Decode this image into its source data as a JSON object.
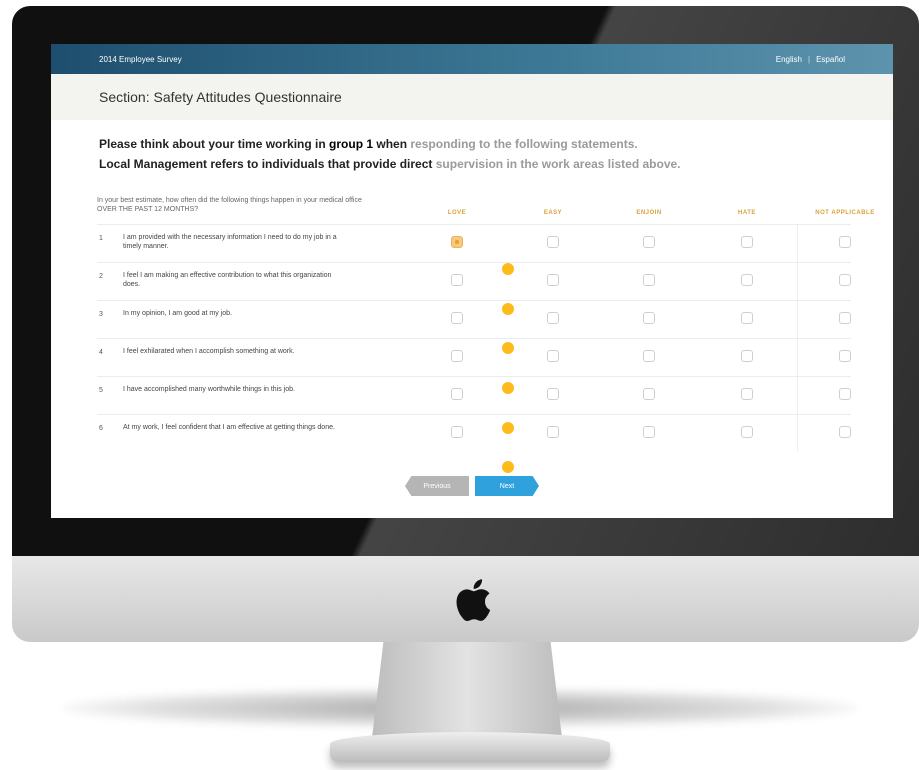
{
  "header": {
    "survey_title": "2014 Employee Survey",
    "lang_english": "English",
    "lang_sep": "|",
    "lang_espanol": "Español"
  },
  "section": {
    "title": "Section: Safety Attitudes Questionnaire"
  },
  "intro": {
    "line1_pre": "Please think about your time working in ",
    "line1_bold": "group 1",
    "line1_mid": " when ",
    "line1_fade": "responding to the following statements.",
    "line2_pre": "Local Management refers to individuals that provide direct ",
    "line2_fade": "supervision in the work areas listed above."
  },
  "question": {
    "prompt": "In your best estimate, how often did the following things happen in your medical office OVER THE PAST 12 MONTHS?",
    "columns": [
      "LOVE",
      "EASY",
      "ENJOIN",
      "HATE",
      "NOT APPLICABLE"
    ]
  },
  "rows": [
    {
      "num": "1",
      "text": "I am provided with the necessary information I need to do my job in a timely manner.",
      "selected": 0
    },
    {
      "num": "2",
      "text": "I feel I am making an effective contribution to what this organization does.",
      "selected": -1
    },
    {
      "num": "3",
      "text": "In my opinion, I am good at my job.",
      "selected": -1
    },
    {
      "num": "4",
      "text": "I feel exhilarated when I accomplish something at work.",
      "selected": -1
    },
    {
      "num": "5",
      "text": "I have accomplished many worthwhile things in this job.",
      "selected": -1
    },
    {
      "num": "6",
      "text": "At my work, I feel confident that I am effective at getting things done.",
      "selected": -1
    }
  ],
  "buttons": {
    "previous": "Previous",
    "next": "Next"
  },
  "colors": {
    "accent_blue": "#2fa2dd",
    "header_blue": "#1e4e6e",
    "marker": "#fdbc1b",
    "column_label": "#d9a23a"
  }
}
